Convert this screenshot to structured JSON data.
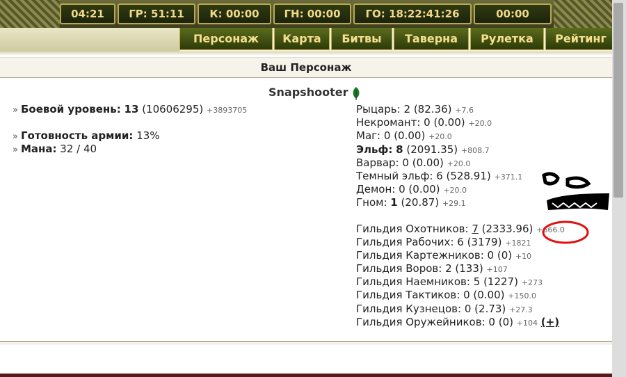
{
  "timers": [
    "04:21",
    "ГР: 51:11",
    "К: 00:00",
    "ГН: 00:00",
    "ГО: 18:22:41:26",
    "00:00"
  ],
  "nav": [
    "Персонаж",
    "Карта",
    "Битвы",
    "Таверна",
    "Рулетка",
    "Рейтинг"
  ],
  "page_title": "Ваш Персонаж",
  "character": {
    "name": "Snapshooter",
    "combat_level_label": "Боевой уровень:",
    "combat_level": "13",
    "combat_exp": "(10606295)",
    "combat_exp_delta": "+3893705",
    "army_ready_label": "Готовность армии:",
    "army_ready": "13%",
    "mana_label": "Мана:",
    "mana": "32 / 40"
  },
  "factions": [
    {
      "name": "Рыцарь:",
      "level": "2",
      "points": "(82.36)",
      "delta": "+7.6"
    },
    {
      "name": "Некромант:",
      "level": "0",
      "points": "(0.00)",
      "delta": "+20.0"
    },
    {
      "name": "Маг:",
      "level": "0",
      "points": "(0.00)",
      "delta": "+20.0"
    },
    {
      "name": "Эльф:",
      "level": "8",
      "points": "(2091.35)",
      "delta": "+808.7"
    },
    {
      "name": "Варвар:",
      "level": "0",
      "points": "(0.00)",
      "delta": "+20.0"
    },
    {
      "name": "Темный эльф:",
      "level": "6",
      "points": "(528.91)",
      "delta": "+371.1"
    },
    {
      "name": "Демон:",
      "level": "0",
      "points": "(0.00)",
      "delta": "+20.0"
    },
    {
      "name": "Гном:",
      "level": "1",
      "points": "(20.87)",
      "delta": "+29.1"
    }
  ],
  "guilds": [
    {
      "name": "Гильдия Охотников:",
      "level": "7",
      "points": "(2333.96)",
      "delta": "+666.0"
    },
    {
      "name": "Гильдия Рабочих:",
      "level": "6",
      "points": "(3179)",
      "delta": "+1821"
    },
    {
      "name": "Гильдия Картежников:",
      "level": "0",
      "points": "(0)",
      "delta": "+10"
    },
    {
      "name": "Гильдия Воров:",
      "level": "2",
      "points": "(133)",
      "delta": "+107"
    },
    {
      "name": "Гильдия Наемников:",
      "level": "5",
      "points": "(1227)",
      "delta": "+273"
    },
    {
      "name": "Гильдия Тактиков:",
      "level": "0",
      "points": "(0.00)",
      "delta": "+150.0"
    },
    {
      "name": "Гильдия Кузнецов:",
      "level": "0",
      "points": "(2.73)",
      "delta": "+27.3"
    },
    {
      "name": "Гильдия Оружейников:",
      "level": "0",
      "points": "(0)",
      "delta": "+104"
    }
  ],
  "plus_button": "(+)",
  "colors": {
    "accent_gold": "#f1d98a",
    "nav_green": "#2d3a08",
    "annotation_red": "#e01010",
    "leaf_green": "#1e7a2a"
  }
}
